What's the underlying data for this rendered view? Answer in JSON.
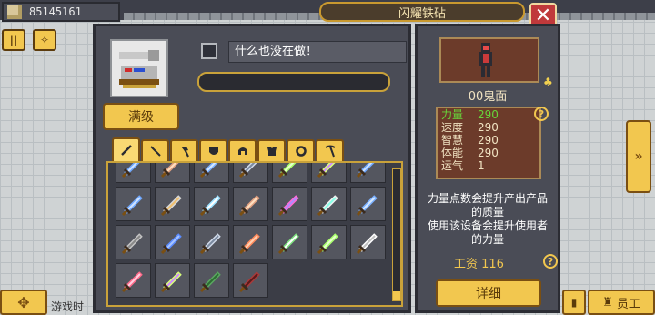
{
  "top": {
    "money": "85145161"
  },
  "title": "闪耀铁砧",
  "item": {
    "name_value": "什么也没在做！",
    "progress": 0
  },
  "max_label": "满级",
  "tabs": [
    {
      "name": "sword-icon",
      "active": true
    },
    {
      "name": "spear-icon"
    },
    {
      "name": "axe-icon"
    },
    {
      "name": "shield-icon"
    },
    {
      "name": "helmet-icon"
    },
    {
      "name": "armor-icon"
    },
    {
      "name": "ring-icon"
    },
    {
      "name": "pickaxe-icon"
    }
  ],
  "character": {
    "name": "00鬼面",
    "stats": [
      {
        "label": "力量",
        "value": "290"
      },
      {
        "label": "速度",
        "value": "290"
      },
      {
        "label": "智慧",
        "value": "290"
      },
      {
        "label": "体能",
        "value": "290"
      },
      {
        "label": "运气",
        "value": "1"
      }
    ],
    "desc_line1": "力量点数会提升产出产品",
    "desc_line2": "的质量",
    "desc_line3": "使用该设备会提升使用者",
    "desc_line4": "的力量",
    "wage": "工资 116",
    "detail_label": "详细"
  },
  "bottom": {
    "game_time": "游戏时",
    "staff_label": "员工"
  },
  "colors": {
    "gold": "#f2c74f",
    "panel": "#4a4c56",
    "brown": "#6c3b2a",
    "green": "#67d53a",
    "close": "#c0393b"
  }
}
